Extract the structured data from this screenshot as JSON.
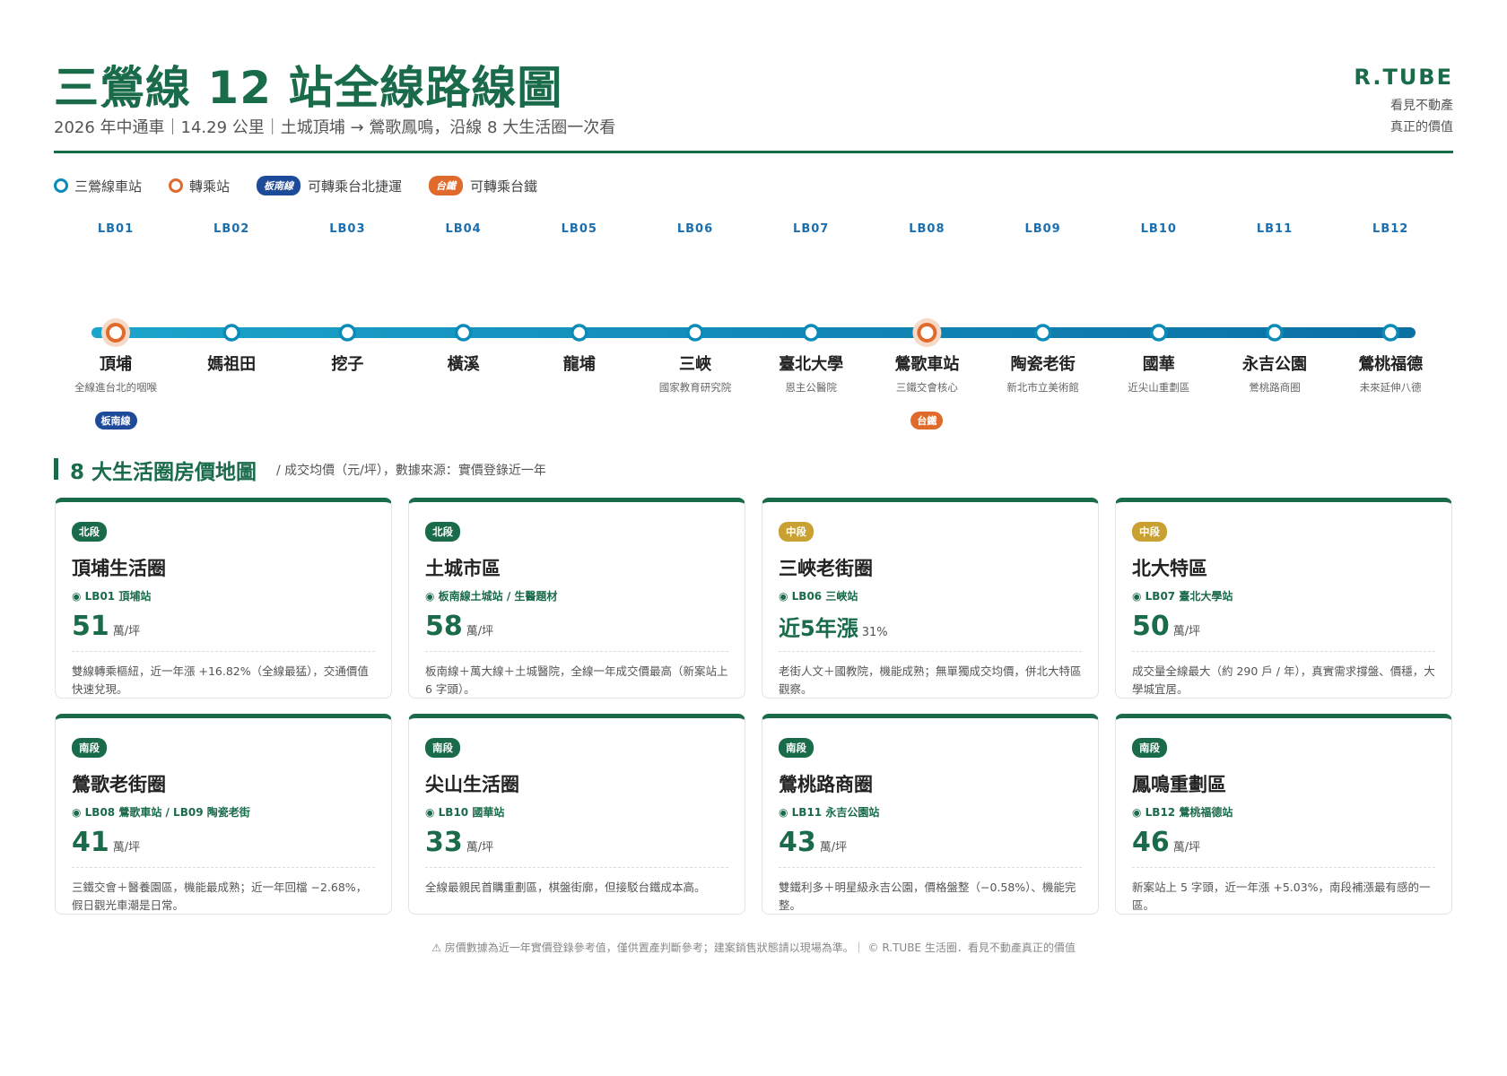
{
  "header": {
    "title": "三鶯線 12 站全線路線圖",
    "subtitle": "2026 年中通車｜14.29 公里｜土城頂埔 → 鶯歌鳳鳴，沿線 8 大生活圈一次看",
    "brand_name": "R.TUBE",
    "brand_line1": "看見不動產",
    "brand_line2": "真正的價值"
  },
  "legend": {
    "station": "三鶯線車站",
    "transfer": "轉乘站",
    "mrt_pill": "板南線",
    "mrt_label": "可轉乘台北捷運",
    "rail_pill": "台鐵",
    "rail_label": "可轉乘台鐵"
  },
  "colors": {
    "brand_green": "#1a6b4a",
    "line_blue": "#0a8bb8",
    "transfer_orange": "#e06a2c",
    "mrt_blue": "#1e4a9a",
    "mid_gold": "#c9a032"
  },
  "stations": [
    {
      "code": "LB01",
      "name": "頂埔",
      "note": "全線進台北的咽喉",
      "transfer": true,
      "badge": "板南線",
      "badge_color": "blue"
    },
    {
      "code": "LB02",
      "name": "媽祖田",
      "note": "",
      "transfer": false,
      "badge": "",
      "badge_color": ""
    },
    {
      "code": "LB03",
      "name": "挖子",
      "note": "",
      "transfer": false,
      "badge": "",
      "badge_color": ""
    },
    {
      "code": "LB04",
      "name": "橫溪",
      "note": "",
      "transfer": false,
      "badge": "",
      "badge_color": ""
    },
    {
      "code": "LB05",
      "name": "龍埔",
      "note": "",
      "transfer": false,
      "badge": "",
      "badge_color": ""
    },
    {
      "code": "LB06",
      "name": "三峽",
      "note": "國家教育研究院",
      "transfer": false,
      "badge": "",
      "badge_color": ""
    },
    {
      "code": "LB07",
      "name": "臺北大學",
      "note": "恩主公醫院",
      "transfer": false,
      "badge": "",
      "badge_color": ""
    },
    {
      "code": "LB08",
      "name": "鶯歌車站",
      "note": "三鐵交會核心",
      "transfer": true,
      "badge": "台鐵",
      "badge_color": "orange"
    },
    {
      "code": "LB09",
      "name": "陶瓷老街",
      "note": "新北市立美術館",
      "transfer": false,
      "badge": "",
      "badge_color": ""
    },
    {
      "code": "LB10",
      "name": "國華",
      "note": "近尖山重劃區",
      "transfer": false,
      "badge": "",
      "badge_color": ""
    },
    {
      "code": "LB11",
      "name": "永吉公園",
      "note": "鶯桃路商圈",
      "transfer": false,
      "badge": "",
      "badge_color": ""
    },
    {
      "code": "LB12",
      "name": "鶯桃福德",
      "note": "未來延伸八德",
      "transfer": false,
      "badge": "",
      "badge_color": ""
    }
  ],
  "section": {
    "title": "8 大生活圈房價地圖",
    "note": "/ 成交均價（元/坪），數據來源：實價登錄近一年"
  },
  "cards": [
    {
      "tag": "北段",
      "tag_color": "#1a6b4a",
      "name": "頂埔生活圈",
      "station": "◉ LB01 頂埔站",
      "price": "51",
      "unit": "萬/坪",
      "desc": "雙線轉乘樞紐，近一年漲 +16.82%（全線最猛），交通價值快速兌現。"
    },
    {
      "tag": "北段",
      "tag_color": "#1a6b4a",
      "name": "土城市區",
      "station": "◉ 板南線土城站 / 生醫題材",
      "price": "58",
      "unit": "萬/坪",
      "desc": "板南線＋萬大線＋土城醫院，全線一年成交價最高（新案站上 6 字頭）。"
    },
    {
      "tag": "中段",
      "tag_color": "#c9a032",
      "name": "三峽老街圈",
      "station": "◉ LB06 三峽站",
      "price": "近5年漲",
      "unit": "31%",
      "desc": "老街人文＋國教院，機能成熟；無單獨成交均價，併北大特區觀察。"
    },
    {
      "tag": "中段",
      "tag_color": "#c9a032",
      "name": "北大特區",
      "station": "◉ LB07 臺北大學站",
      "price": "50",
      "unit": "萬/坪",
      "desc": "成交量全線最大（約 290 戶 / 年），真實需求撐盤、價穩，大學城宜居。"
    },
    {
      "tag": "南段",
      "tag_color": "#1a6b4a",
      "name": "鶯歌老街圈",
      "station": "◉ LB08 鶯歌車站 / LB09 陶瓷老街",
      "price": "41",
      "unit": "萬/坪",
      "desc": "三鐵交會＋醫養園區，機能最成熟；近一年回檔 −2.68%，假日觀光車潮是日常。"
    },
    {
      "tag": "南段",
      "tag_color": "#1a6b4a",
      "name": "尖山生活圈",
      "station": "◉ LB10 國華站",
      "price": "33",
      "unit": "萬/坪",
      "desc": "全線最親民首購重劃區，棋盤街廓，但接駁台鐵成本高。"
    },
    {
      "tag": "南段",
      "tag_color": "#1a6b4a",
      "name": "鶯桃路商圈",
      "station": "◉ LB11 永吉公園站",
      "price": "43",
      "unit": "萬/坪",
      "desc": "雙鐵利多＋明星級永吉公園，價格盤整（−0.58%）、機能完整。"
    },
    {
      "tag": "南段",
      "tag_color": "#1a6b4a",
      "name": "鳳鳴重劃區",
      "station": "◉ LB12 鶯桃福德站",
      "price": "46",
      "unit": "萬/坪",
      "desc": "新案站上 5 字頭，近一年漲 +5.03%，南段補漲最有感的一區。"
    }
  ],
  "footer": "⚠ 房價數據為近一年實價登錄參考值，僅供置產判斷參考；建案銷售狀態請以現場為準。｜ © R.TUBE 生活圈．看見不動產真正的價值"
}
